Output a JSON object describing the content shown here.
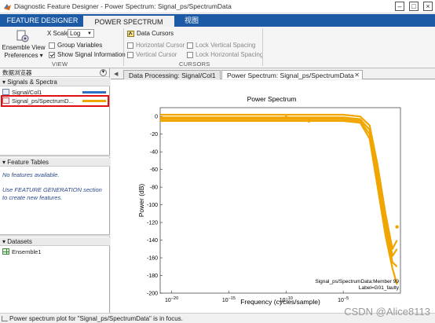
{
  "window": {
    "title": "Diagnostic Feature Designer - Power Spectrum: Signal_ps/SpectrumData"
  },
  "ribbon_tabs": [
    {
      "label": "FEATURE DESIGNER"
    },
    {
      "label": "POWER SPECTRUM"
    },
    {
      "label": "视图"
    }
  ],
  "ribbon": {
    "ensemble_view": {
      "line1": "Ensemble View",
      "line2": "Preferences ▾"
    },
    "x_scale": {
      "label": "X Scale",
      "value": "Log"
    },
    "group_variables": "Group Variables",
    "show_signal_info": "Show Signal Information",
    "view_group_title": "VIEW",
    "data_cursors": "Data Cursors",
    "horizontal_cursor": "Horizontal Cursor",
    "vertical_cursor": "Vertical Cursor",
    "lock_vertical": "Lock Vertical Spacing",
    "lock_horizontal": "Lock Horizontal Spacing",
    "cursors_group_title": "CURSORS"
  },
  "left": {
    "browser_title": "数据浏览器",
    "signals_header": "Signals & Spectra",
    "signals": [
      {
        "label": "Signal/Col1",
        "color": "#2f6fc6"
      },
      {
        "label": "Signal_ps/SpectrumD...",
        "color": "#f0a500"
      }
    ],
    "feature_tables_header": "Feature Tables",
    "no_features": "No features available.",
    "use_fg_line1": "Use FEATURE GENERATION section",
    "use_fg_line2": "to create new features.",
    "datasets_header": "Datasets",
    "dataset": "Ensemble1"
  },
  "doc_tabs": [
    {
      "label": "Data Processing: Signal/Col1"
    },
    {
      "label": "Power Spectrum: Signal_ps/SpectrumData"
    }
  ],
  "plot": {
    "title": "Power Spectrum",
    "xlabel": "Frequency (cycles/sample)",
    "ylabel": "Power (dB)",
    "info_line1": "Signal_ps/SpectrumData:Member 99",
    "info_line2": "Label=G01_faulty"
  },
  "chart_data": {
    "type": "line",
    "title": "Power Spectrum",
    "xlabel": "Frequency (cycles/sample)",
    "ylabel": "Power (dB)",
    "x_scale": "log",
    "xlim": [
      1e-21,
      1
    ],
    "ylim": [
      -200,
      10
    ],
    "x_ticks": [
      "10^-20",
      "10^-15",
      "10^-10",
      "10^-5"
    ],
    "y_ticks": [
      -200,
      -180,
      -160,
      -140,
      -120,
      -100,
      -80,
      -60,
      -40,
      -20,
      0
    ],
    "series_color": "#f0a500",
    "series": [
      {
        "x": [
          1e-21,
          1e-16,
          1e-11,
          1e-07,
          1e-05,
          0.0003,
          0.002,
          0.01,
          0.05,
          0.2,
          0.5
        ],
        "values": [
          2,
          2,
          2,
          2,
          2,
          0,
          -10,
          -55,
          -110,
          -150,
          -140
        ]
      },
      {
        "x": [
          1e-21,
          1e-16,
          1e-11,
          1e-07,
          1e-05,
          0.0003,
          0.002,
          0.01,
          0.05,
          0.2,
          0.5
        ],
        "values": [
          -1,
          -1,
          -1,
          -1,
          -1,
          -3,
          -15,
          -60,
          -115,
          -158,
          -150
        ]
      },
      {
        "x": [
          1e-21,
          1e-16,
          1e-11,
          1e-07,
          1e-05,
          0.0003,
          0.002,
          0.01,
          0.05,
          0.2,
          0.5
        ],
        "values": [
          -3,
          -3,
          -3,
          -3,
          -3,
          -5,
          -20,
          -70,
          -125,
          -165,
          -170
        ]
      },
      {
        "x": [
          1e-21,
          1e-16,
          1e-11,
          1e-07,
          1e-05,
          0.0003,
          0.002,
          0.01,
          0.05,
          0.2,
          0.5
        ],
        "values": [
          -5,
          -5,
          -5,
          -5,
          -5,
          -7,
          -25,
          -80,
          -135,
          -172,
          -190
        ]
      }
    ],
    "markers": [
      {
        "x": 1e-10,
        "y": -1
      },
      {
        "x": 1e-08,
        "y": -5
      },
      {
        "x": 0.5,
        "y": -125
      }
    ]
  },
  "status": {
    "text": "Power spectrum plot for \"Signal_ps/SpectrumData\" is in focus."
  },
  "watermark": "CSDN @Alice8113"
}
